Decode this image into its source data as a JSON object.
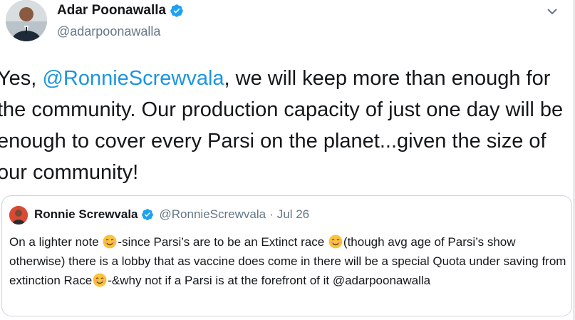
{
  "tweet": {
    "author_name": "Adar Poonawalla",
    "author_handle": "@adarpoonawalla",
    "text_before": "Yes, ",
    "mention": "@RonnieScrewvala",
    "text_after": ", we will keep more than enough for the community. Our production capacity of just one day will be enough to cover every Parsi on the planet...given the size of our community!"
  },
  "quote": {
    "author_name": "Ronnie Screwvala",
    "author_handle": "@RonnieScrewvala",
    "separator": "·",
    "date": "Jul 26",
    "text_1": "On a lighter note ",
    "text_2": "-since Parsi’s are to be an Extinct race ",
    "text_3": "(though avg age of Parsi’s show otherwise) there is a lobby that as vaccine does come in there will be a special Quota under saving from extinction Race",
    "text_4": "-&why not if a Parsi is at the forefront of it @adarpoonawalla"
  },
  "icons": {
    "verified": "verified-badge-icon",
    "caret": "chevron-down-icon",
    "emoji": "smiling-face-icon"
  },
  "colors": {
    "link": "#1b95e0",
    "secondary": "#657786",
    "border": "#ccd6dd",
    "verified": "#1da1f2"
  }
}
